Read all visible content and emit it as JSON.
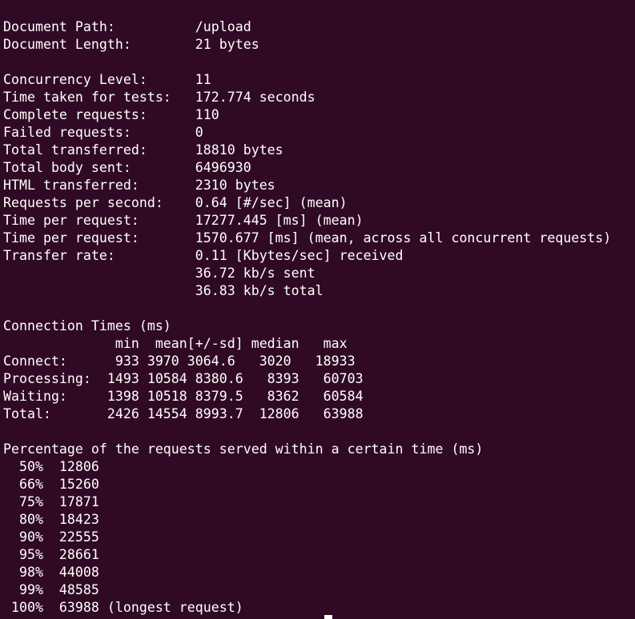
{
  "report": {
    "lines": [
      "Document Path:          /upload",
      "Document Length:        21 bytes",
      "",
      "Concurrency Level:      11",
      "Time taken for tests:   172.774 seconds",
      "Complete requests:      110",
      "Failed requests:        0",
      "Total transferred:      18810 bytes",
      "Total body sent:        6496930",
      "HTML transferred:       2310 bytes",
      "Requests per second:    0.64 [#/sec] (mean)",
      "Time per request:       17277.445 [ms] (mean)",
      "Time per request:       1570.677 [ms] (mean, across all concurrent requests)",
      "Transfer rate:          0.11 [Kbytes/sec] received",
      "                        36.72 kb/s sent",
      "                        36.83 kb/s total",
      "",
      "Connection Times (ms)",
      "              min  mean[+/-sd] median   max",
      "Connect:      933 3970 3064.6   3020   18933",
      "Processing:  1493 10584 8380.6   8393   60703",
      "Waiting:     1398 10518 8379.5   8362   60584",
      "Total:       2426 14554 8993.7  12806   63988",
      "",
      "Percentage of the requests served within a certain time (ms)",
      "  50%  12806",
      "  66%  15260",
      "  75%  17871",
      "  80%  18423",
      "  90%  22555",
      "  95%  28661",
      "  98%  44008",
      "  99%  48585",
      " 100%  63988 (longest request)"
    ]
  }
}
